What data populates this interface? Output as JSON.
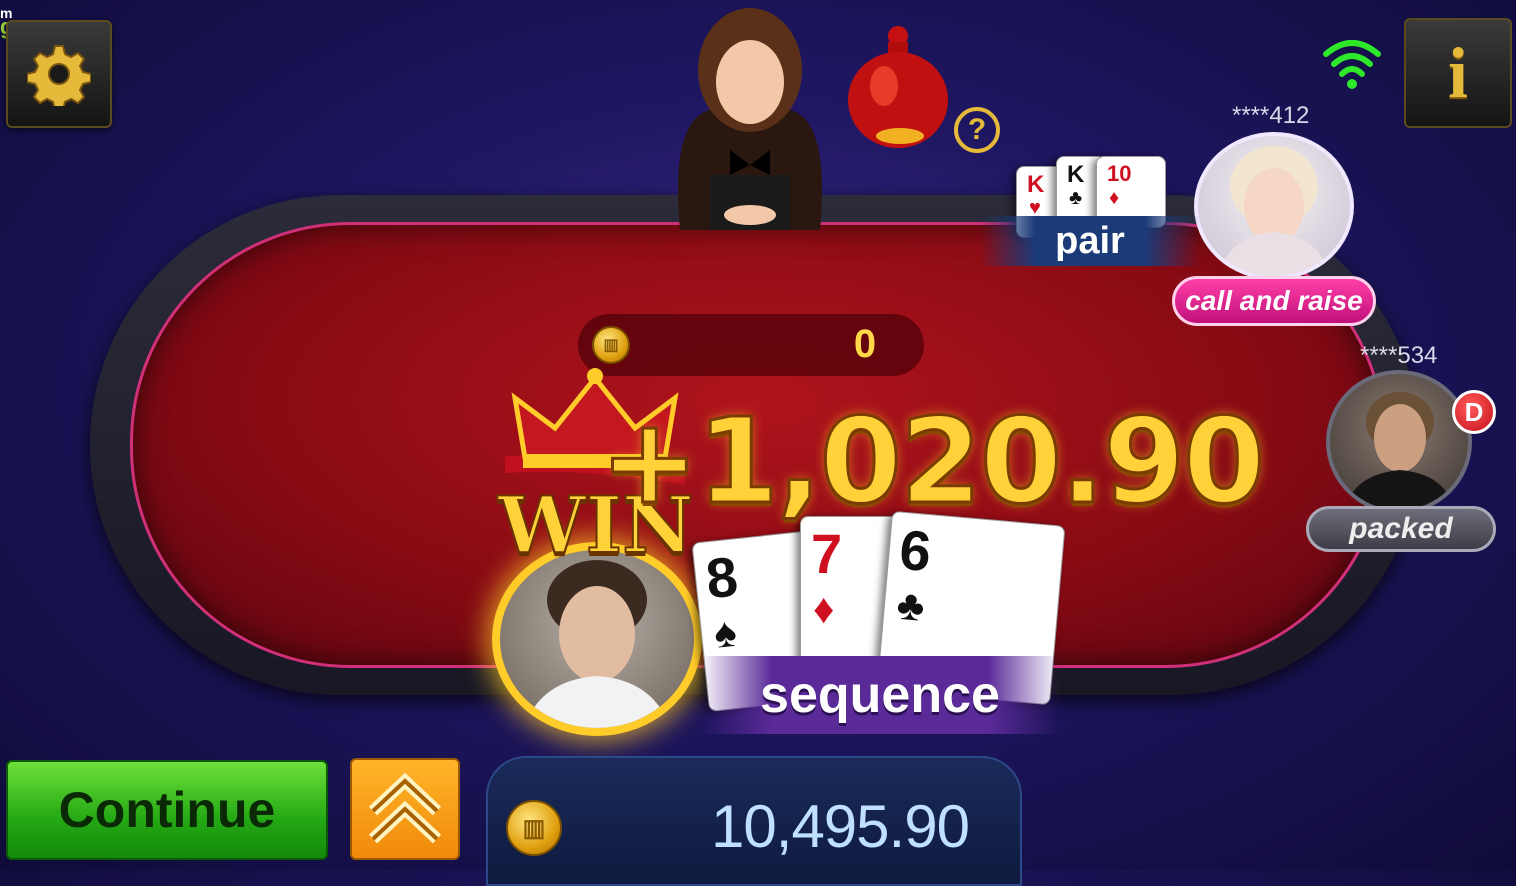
{
  "corner": {
    "line1": "m",
    "line2": "g"
  },
  "toolbar": {
    "settings_icon": "gear-icon",
    "info_label": "i",
    "wifi_icon": "wifi-icon",
    "help_label": "?"
  },
  "pot": {
    "amount": "0",
    "coin_icon": "coin-icon"
  },
  "win": {
    "word": "WIN",
    "amount": "+1,020.90"
  },
  "players": {
    "self": {
      "hand_label": "sequence",
      "cards": [
        {
          "rank": "8",
          "suit": "♠",
          "color": "black"
        },
        {
          "rank": "7",
          "suit": "♦",
          "color": "red"
        },
        {
          "rank": "6",
          "suit": "♣",
          "color": "black"
        }
      ]
    },
    "p412": {
      "id": "****412",
      "action": "call and raise",
      "hand_label": "pair",
      "cards": [
        {
          "rank": "K",
          "suit": "♥",
          "color": "red"
        },
        {
          "rank": "K",
          "suit": "♣",
          "color": "black"
        },
        {
          "rank": "10",
          "suit": "♦",
          "color": "red"
        }
      ]
    },
    "p534": {
      "id": "****534",
      "status": "packed",
      "dealer_badge": "D"
    }
  },
  "bottom": {
    "continue_label": "Continue",
    "balance": "10,495.90"
  },
  "colors": {
    "felt": "#8a0b14",
    "accent_gold": "#ffd23a",
    "continue_green": "#24a814",
    "pink": "#d0307a"
  }
}
